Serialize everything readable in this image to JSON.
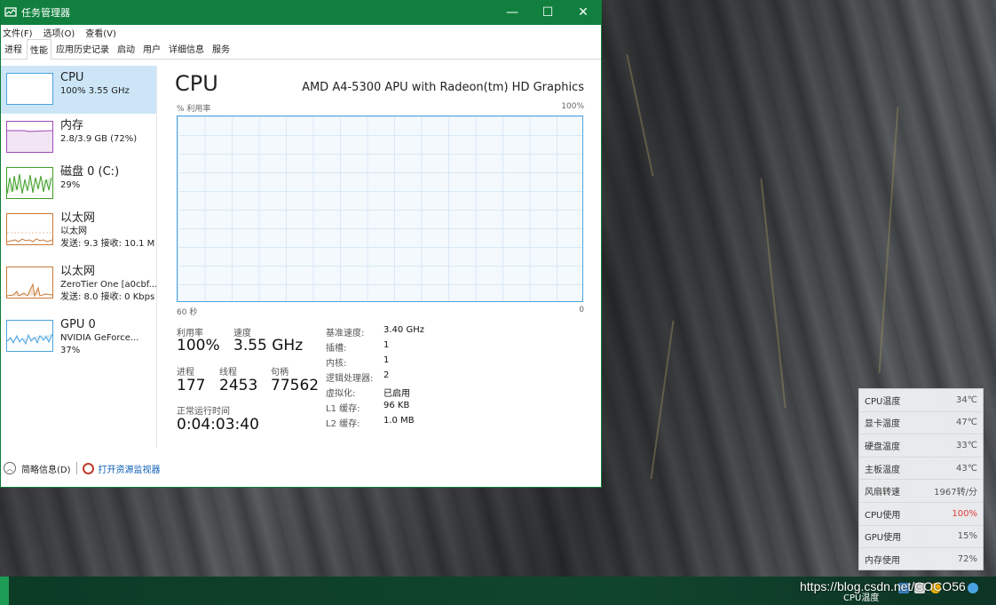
{
  "window": {
    "title": "任务管理器",
    "minimize": "—",
    "maximize": "☐",
    "close": "✕"
  },
  "menu": [
    "文件(F)",
    "选项(O)",
    "查看(V)"
  ],
  "tabs": [
    "进程",
    "性能",
    "应用历史记录",
    "启动",
    "用户",
    "详细信息",
    "服务"
  ],
  "active_tab": "性能",
  "resources": [
    {
      "name": "CPU",
      "sub1": "100%  3.55 GHz",
      "sub2": "",
      "sub3": "",
      "color": "#4ba3dd"
    },
    {
      "name": "内存",
      "sub1": "2.8/3.9 GB (72%)",
      "sub2": "",
      "sub3": "",
      "color": "#a14cb8"
    },
    {
      "name": "磁盘 0 (C:)",
      "sub1": "29%",
      "sub2": "",
      "sub3": "",
      "color": "#3f9e27"
    },
    {
      "name": "以太网",
      "sub1": "以太网",
      "sub2": "发送: 9.3 接收: 10.1 M",
      "sub3": "",
      "color": "#c87a3a"
    },
    {
      "name": "以太网",
      "sub1": "ZeroTier One [a0cbf...",
      "sub2": "发送: 8.0 接收: 0 Kbps",
      "sub3": "",
      "color": "#c87a3a"
    },
    {
      "name": "GPU 0",
      "sub1": "NVIDIA GeForce...",
      "sub2": "37%",
      "sub3": "",
      "color": "#4ba3dd"
    }
  ],
  "cpu": {
    "title": "CPU",
    "model": "AMD A4-5300 APU with Radeon(tm) HD Graphics",
    "graph_label": "% 利用率",
    "graph_max": "100%",
    "graph_time": "60 秒",
    "graph_min": "0",
    "util_label": "利用率",
    "util_value": "100%",
    "speed_label": "速度",
    "speed_value": "3.55 GHz",
    "proc_label": "进程",
    "proc_value": "177",
    "thread_label": "线程",
    "thread_value": "2453",
    "handle_label": "句柄",
    "handle_value": "77562",
    "uptime_label": "正常运行时间",
    "uptime_value": "0:04:03:40",
    "specs": [
      {
        "k": "基准速度:",
        "v": "3.40 GHz"
      },
      {
        "k": "插槽:",
        "v": "1"
      },
      {
        "k": "内核:",
        "v": "1"
      },
      {
        "k": "逻辑处理器:",
        "v": "2"
      },
      {
        "k": "虚拟化:",
        "v": "已启用"
      },
      {
        "k": "L1 缓存:",
        "v": "96 KB"
      },
      {
        "k": "L2 缓存:",
        "v": "1.0 MB"
      }
    ]
  },
  "footer": {
    "summary": "简略信息(D)",
    "monitor": "打开资源监视器"
  },
  "sensor": [
    {
      "k": "CPU温度",
      "v": "34℃",
      "hot": false
    },
    {
      "k": "显卡温度",
      "v": "47℃",
      "hot": false
    },
    {
      "k": "硬盘温度",
      "v": "33℃",
      "hot": false
    },
    {
      "k": "主板温度",
      "v": "43℃",
      "hot": false
    },
    {
      "k": "风扇转速",
      "v": "1967转/分",
      "hot": false
    },
    {
      "k": "CPU使用",
      "v": "100%",
      "hot": true
    },
    {
      "k": "GPU使用",
      "v": "15%",
      "hot": false
    },
    {
      "k": "内存使用",
      "v": "72%",
      "hot": false
    }
  ],
  "taskbar": {
    "tray_label": "CPU温度",
    "watermark": "https://blog.csdn.net/COCO56"
  }
}
